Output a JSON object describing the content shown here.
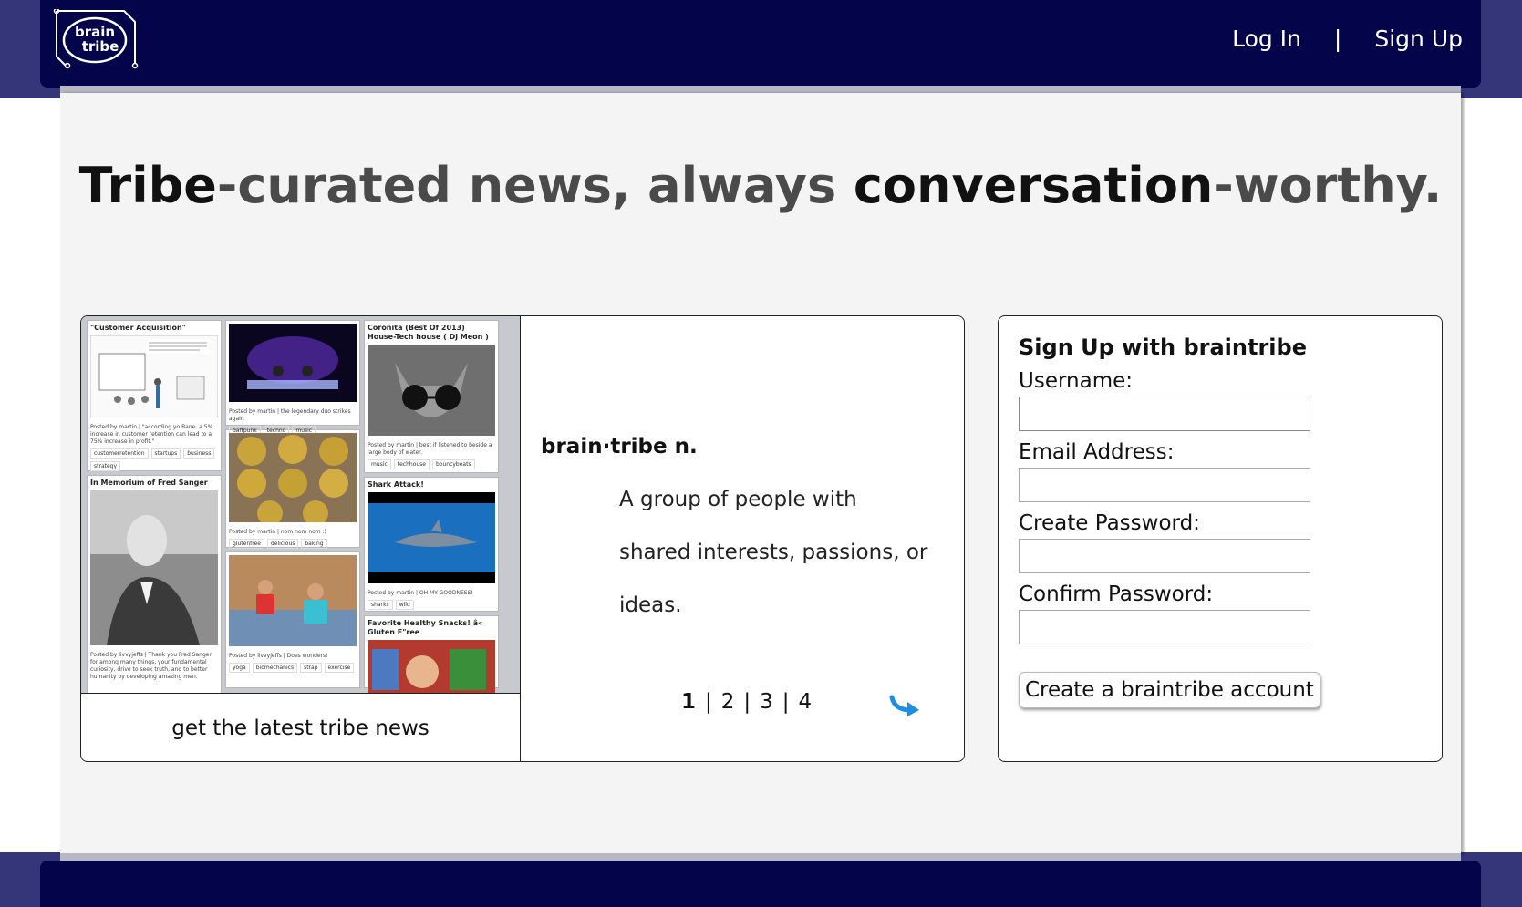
{
  "header": {
    "logo_line1": "brain",
    "logo_line2": "tribe",
    "login_label": "Log In",
    "separator": "|",
    "signup_label": "Sign Up"
  },
  "headline": {
    "part1": "Tribe",
    "part2": "-curated news, always ",
    "part3": "conversation",
    "part4": "-worthy."
  },
  "showcase": {
    "caption": "get the latest tribe news",
    "feed": {
      "col1": [
        {
          "title": "\"Customer Acquisition\"",
          "meta": "Posted by martin | \"according yo Bane, a 5% increase in customer retention can lead to a 75% increase in profit.\"",
          "tags": [
            "customerretention",
            "startups",
            "business",
            "strategy"
          ]
        },
        {
          "title": "In Memorium of Fred Sanger",
          "meta": "Posted by livvyjeffs | Thank you Fred Sanger for among many things, your fundamental curiosity, drive to seek truth, and to better humanity by developing amazing men.",
          "tags": []
        }
      ],
      "col2": [
        {
          "title": "",
          "meta": "Posted by martin | the legendary duo strikes again",
          "tags": [
            "daftpunk",
            "techno",
            "music"
          ]
        },
        {
          "title": "",
          "meta": "Posted by martin | nom nom nom :)",
          "tags": [
            "glutenfree",
            "delicious",
            "baking"
          ]
        },
        {
          "title": "",
          "meta": "Posted by livvyjeffs | Does wonders!",
          "tags": [
            "yoga",
            "biomechanics",
            "strap",
            "exercise"
          ]
        }
      ],
      "col3": [
        {
          "title": "Coronita (Best Of 2013) House-Tech house ( Dj Meon )",
          "meta": "Posted by martin | best if listened to beside a large body of water.",
          "tags": [
            "music",
            "techhouse",
            "bouncybeats"
          ]
        },
        {
          "title": "Shark Attack!",
          "meta": "Posted by martin | OH MY GOODNESS!",
          "tags": [
            "sharks",
            "wild"
          ]
        },
        {
          "title": "Favorite Healthy Snacks! â« Gluten F\"ree",
          "meta": "",
          "tags": []
        }
      ]
    }
  },
  "definition": {
    "term": "brain·tribe n.",
    "text": "A group of people with shared interests, passions, or ideas.",
    "pages": [
      "1",
      "2",
      "3",
      "4"
    ],
    "page_sep": "|",
    "active_page": "1"
  },
  "signup": {
    "title": "Sign Up with braintribe",
    "username_label": "Username:",
    "email_label": "Email Address:",
    "password_label": "Create Password:",
    "confirm_label": "Confirm Password:",
    "submit_label": "Create a braintribe account"
  },
  "colors": {
    "header_bg": "#04044a",
    "side_band": "#35357a",
    "page_bg": "#f4f4f4",
    "arrow": "#1e8fe0"
  }
}
